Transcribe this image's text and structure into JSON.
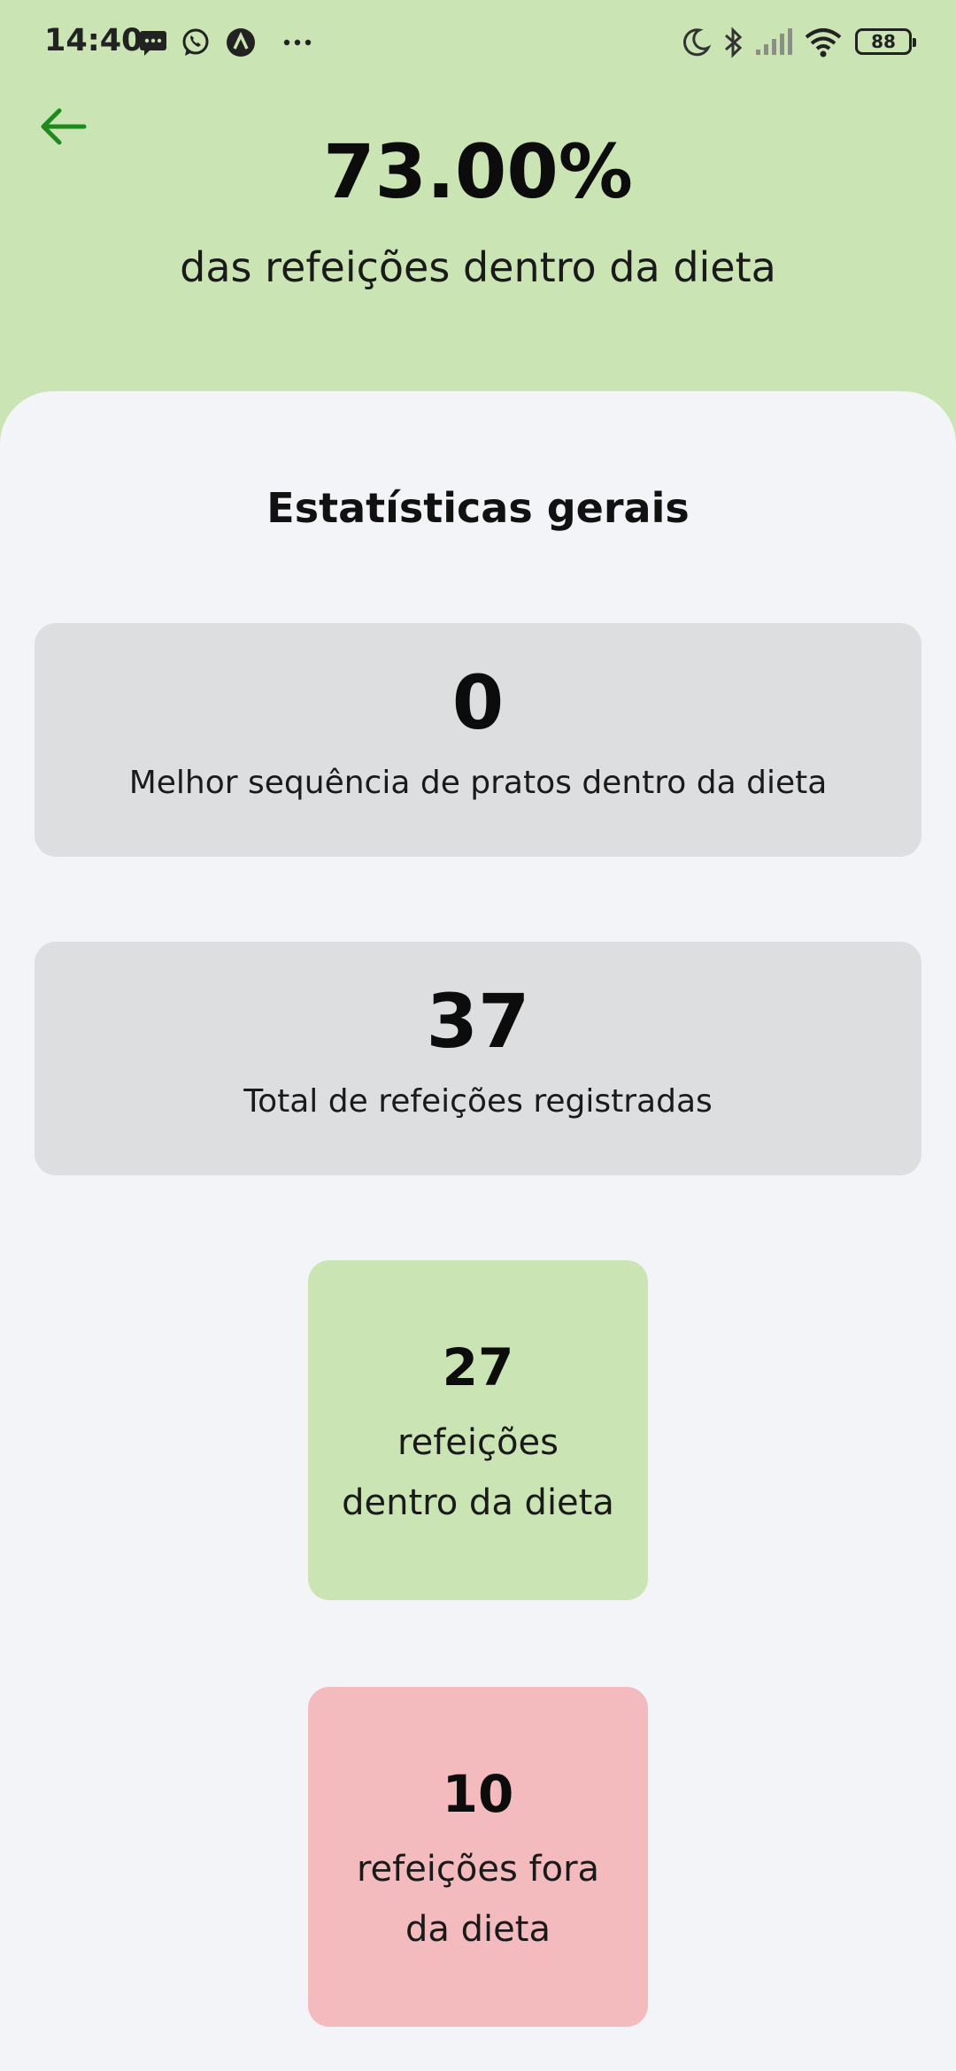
{
  "status_bar": {
    "time": "14:40",
    "battery": "88",
    "icons": [
      "message-icon",
      "whatsapp-icon",
      "app-icon",
      "more-dots-icon",
      "moon-icon",
      "bluetooth-icon",
      "signal-icon",
      "wifi-icon",
      "battery-icon"
    ]
  },
  "header": {
    "back_icon": "arrow-left-icon",
    "percent": "73.00%",
    "percent_label": "das refeições dentro da dieta"
  },
  "stats": {
    "title": "Estatísticas gerais",
    "best_sequence": {
      "value": "0",
      "label": "Melhor sequência de pratos dentro da dieta"
    },
    "total_meals": {
      "value": "37",
      "label": "Total de refeições registradas"
    },
    "within_diet": {
      "value": "27",
      "label_line1": "refeições",
      "label_line2": "dentro da dieta"
    },
    "outside_diet": {
      "value": "10",
      "label_line1": "refeições fora",
      "label_line2": "da dieta"
    }
  },
  "colors": {
    "header_bg": "#CBE4B4",
    "sheet_bg": "#F2F4F7",
    "card_gray": "#DDDEE0",
    "card_green": "#CBE4B4",
    "card_red": "#F3BBBE",
    "accent_green": "#1E8A1E"
  }
}
